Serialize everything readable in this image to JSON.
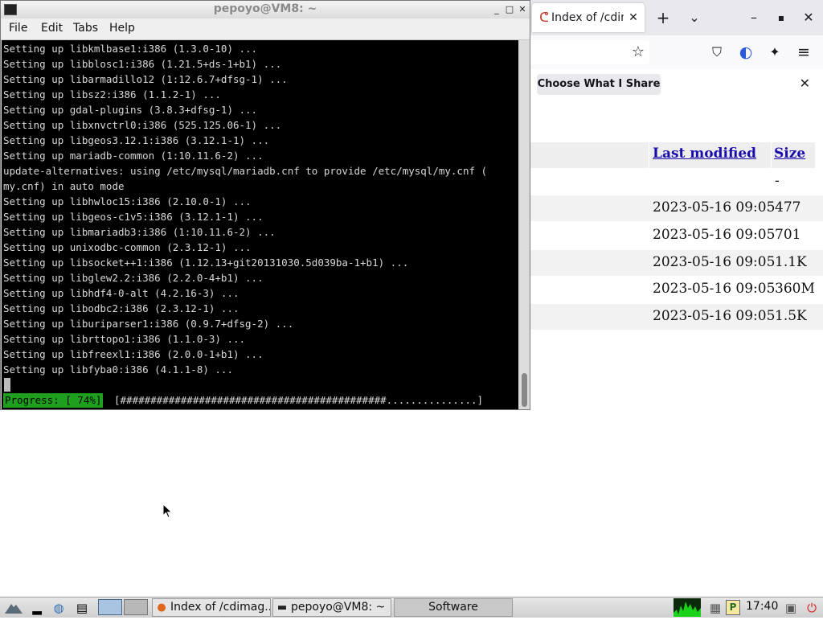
{
  "browser": {
    "tab_title": "Index of /cdimage",
    "url_text": "",
    "share_button": "Choose What I Share",
    "icons": {
      "tab": "debian-swirl-icon",
      "new_tab": "+",
      "tab_list": "⌄",
      "minimize": "–",
      "maximize": "▪",
      "close": "✕",
      "star": "☆",
      "pocket": "⛉",
      "account": "◐",
      "extensions": "✦",
      "menu": "≡",
      "notif_close": "✕"
    },
    "table": {
      "headers": {
        "last_modified": "Last modified",
        "size": "Size"
      },
      "rows": [
        {
          "date": "",
          "size": "-"
        },
        {
          "date": "2023-05-16 09:05",
          "size": "477"
        },
        {
          "date": "2023-05-16 09:05",
          "size": "701"
        },
        {
          "date": "2023-05-16 09:05",
          "size": "1.1K"
        },
        {
          "date": "2023-05-16 09:05",
          "size": "360M"
        },
        {
          "date": "2023-05-16 09:05",
          "size": "1.5K"
        }
      ]
    }
  },
  "terminal": {
    "title": "pepoyo@VM8: ~",
    "menu": [
      "File",
      "Edit",
      "Tabs",
      "Help"
    ],
    "lines": [
      "Setting up libkmlbase1:i386 (1.3.0-10) ...",
      "Setting up libblosc1:i386 (1.21.5+ds-1+b1) ...",
      "Setting up libarmadillo12 (1:12.6.7+dfsg-1) ...",
      "Setting up libsz2:i386 (1.1.2-1) ...",
      "Setting up gdal-plugins (3.8.3+dfsg-1) ...",
      "Setting up libxnvctrl0:i386 (525.125.06-1) ...",
      "Setting up libgeos3.12.1:i386 (3.12.1-1) ...",
      "Setting up mariadb-common (1:10.11.6-2) ...",
      "update-alternatives: using /etc/mysql/mariadb.cnf to provide /etc/mysql/my.cnf (",
      "my.cnf) in auto mode",
      "Setting up libhwloc15:i386 (2.10.0-1) ...",
      "Setting up libgeos-c1v5:i386 (3.12.1-1) ...",
      "Setting up libmariadb3:i386 (1:10.11.6-2) ...",
      "Setting up unixodbc-common (2.3.12-1) ...",
      "Setting up libsocket++1:i386 (1.12.13+git20131030.5d039ba-1+b1) ...",
      "Setting up libglew2.2:i386 (2.2.0-4+b1) ...",
      "Setting up libhdf4-0-alt (4.2.16-3) ...",
      "Setting up libodbc2:i386 (2.3.12-1) ...",
      "Setting up liburiparser1:i386 (0.9.7+dfsg-2) ...",
      "Setting up librttopo1:i386 (1.1.0-3) ...",
      "Setting up libfreexl1:i386 (2.0.0-1+b1) ...",
      "Setting up libfyba0:i386 (4.1.1-8) ..."
    ],
    "progress_label": "Progress: [ 74%]",
    "progress_bar": "[############################################...............]",
    "progress_value": 0.74
  },
  "taskbar": {
    "tasks": [
      {
        "label": "Index of /cdimag...",
        "icon": "firefox-icon"
      },
      {
        "label": "pepoyo@VM8: ~",
        "icon": "terminal-icon"
      },
      {
        "label": "Software",
        "icon": ""
      }
    ],
    "clock": "17:40"
  },
  "colors": {
    "progress_green": "#1ea01e",
    "terminal_bg": "#000000",
    "link": "#1a0dab",
    "logout_red": "#d22222"
  }
}
